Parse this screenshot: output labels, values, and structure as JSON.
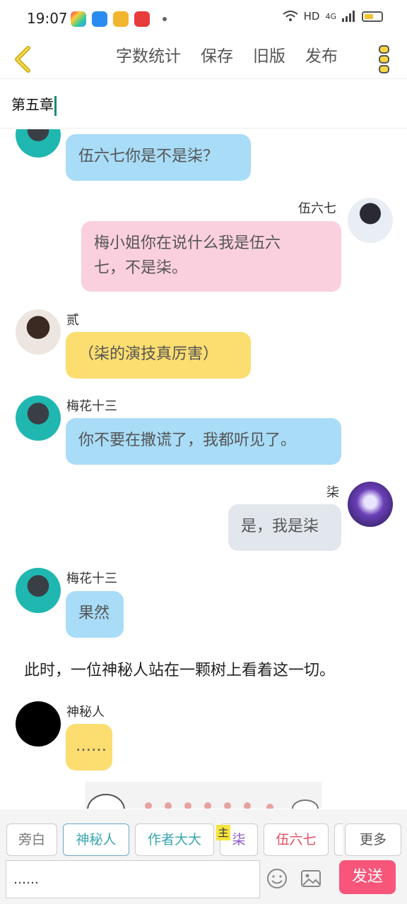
{
  "status_bar": {
    "time": "19:07",
    "network": "HD",
    "cell": "4G"
  },
  "toolbar": {
    "items": [
      "字数统计",
      "保存",
      "旧版",
      "发布"
    ]
  },
  "chapter_title": "第五章",
  "chat": {
    "messages": [
      {
        "speaker": "",
        "text": "伍六七你是不是柒？"
      },
      {
        "speaker": "伍六七",
        "text_line1": "梅小姐你在说什么我是伍六",
        "text_line2": "七，不是柒。"
      },
      {
        "speaker": "贰",
        "text": "（柒的演技真厉害）"
      },
      {
        "speaker": "梅花十三",
        "text": "你不要在撒谎了，我都听见了。"
      },
      {
        "speaker": "柒",
        "text": "是，我是柒"
      },
      {
        "speaker": "梅花十三",
        "text": "果然"
      },
      {
        "narration": "此时，一位神秘人站在一颗树上看着这一切。"
      },
      {
        "speaker": "神秘人",
        "text": "……"
      }
    ]
  },
  "roles": [
    {
      "label": "旁白",
      "color": "#777777"
    },
    {
      "label": "神秘人",
      "color": "#3aa6b0"
    },
    {
      "label": "作者大大",
      "color": "#3aa6b0"
    },
    {
      "label": "柒",
      "color": "#8a5cc8"
    },
    {
      "label": "伍六七",
      "color": "#e05060"
    },
    {
      "label": "更多",
      "color": "#555555"
    }
  ],
  "role_tag": "主",
  "input": {
    "value": "……"
  },
  "send_label": "发送",
  "colors": {
    "bubble_blue": "#a8dcf7",
    "bubble_pink": "#fbd0de",
    "bubble_yellow": "#fbdd70",
    "bubble_gray": "#e2e7ee",
    "send": "#f7557a",
    "accent": "#f2c12e"
  }
}
